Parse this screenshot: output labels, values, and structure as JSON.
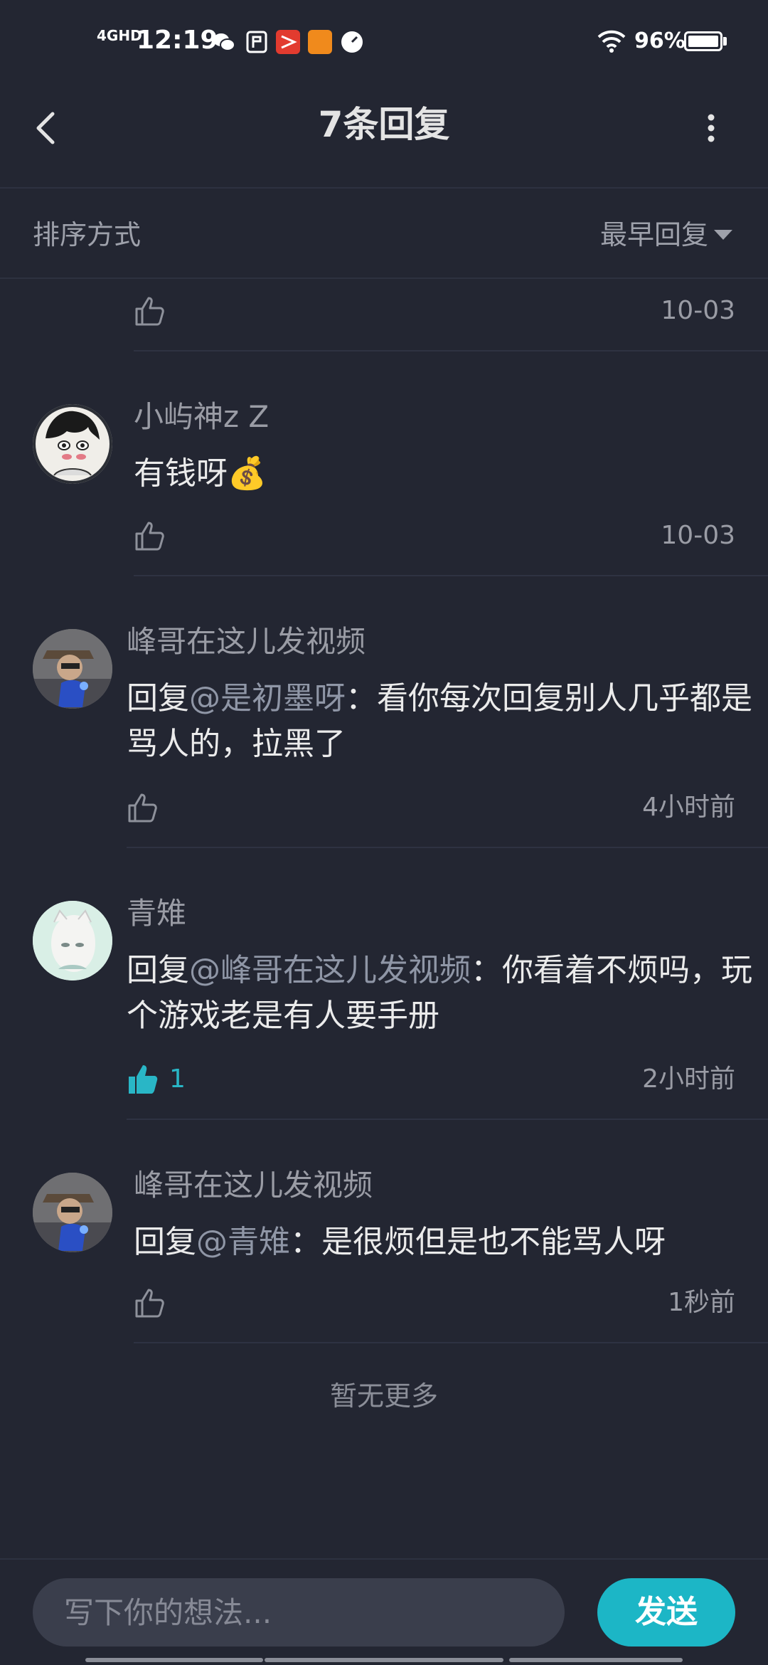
{
  "status_bar": {
    "network": "4GHD",
    "time": "12:19",
    "battery": "96%"
  },
  "header": {
    "title": "7条回复",
    "back_icon": "chevron-left-icon",
    "more_icon": "more-vertical-icon"
  },
  "sort": {
    "label": "排序方式",
    "value": "最早回复"
  },
  "comments": [
    {
      "time": "10-03",
      "liked": false,
      "likes": ""
    },
    {
      "user": "小屿神z Z",
      "text": "有钱呀💰",
      "time": "10-03",
      "liked": false,
      "likes": ""
    },
    {
      "user": "峰哥在这儿发视频",
      "reply_prefix": "回复",
      "mention": "@是初墨呀",
      "text": "：看你每次回复别人几乎都是骂人的，拉黑了",
      "time": "4小时前",
      "liked": false,
      "likes": ""
    },
    {
      "user": "青雉",
      "reply_prefix": "回复",
      "mention": "@峰哥在这儿发视频",
      "text": "：你看着不烦吗，玩个游戏老是有人要手册",
      "time": "2小时前",
      "liked": true,
      "likes": "1"
    },
    {
      "user": "峰哥在这儿发视频",
      "reply_prefix": "回复",
      "mention": "@青雉",
      "text": "：是很烦但是也不能骂人呀",
      "time": "1秒前",
      "liked": false,
      "likes": ""
    }
  ],
  "no_more": "暂无更多",
  "composer": {
    "placeholder": "写下你的想法...",
    "send_label": "发送"
  },
  "colors": {
    "background": "#232632",
    "accent": "#1cb6c6"
  }
}
